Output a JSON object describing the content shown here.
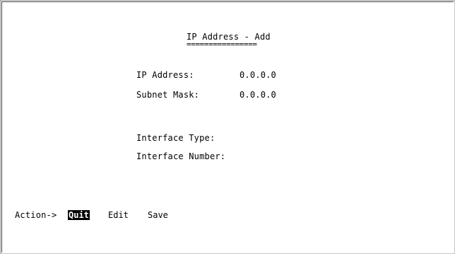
{
  "screen": {
    "title": "IP Address - Add",
    "title_underline": "================"
  },
  "fields": [
    {
      "label": "IP Address:",
      "value": "0.0.0.0"
    },
    {
      "label": "Subnet Mask:",
      "value": "0.0.0.0"
    },
    {
      "label": "Interface Type:",
      "value": ""
    },
    {
      "label": "Interface Number:",
      "value": ""
    }
  ],
  "action_bar": {
    "prompt": "Action->",
    "items": [
      "Quit",
      "Edit",
      "Save"
    ],
    "selected": "Quit"
  },
  "colors": {
    "background": "#ffffff",
    "text": "#000000",
    "highlight_bg": "#000000",
    "highlight_text": "#ffffff"
  }
}
